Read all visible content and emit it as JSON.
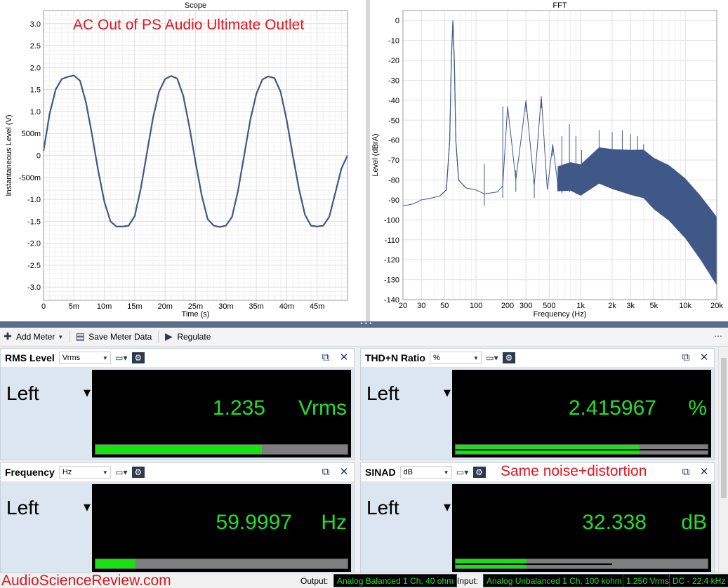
{
  "watermark": "AudioScienceReview.com",
  "annotations": {
    "scope": "AC Out of PS Audio Ultimate Outlet",
    "meters": "Same noise+distortion"
  },
  "colors": {
    "trace": "#3f5888",
    "grid": "#e1e1e1",
    "meter_green": "#22e02a",
    "annotation_red": "#e8121d"
  },
  "chart_data": [
    {
      "type": "line",
      "title": "Scope",
      "xlabel": "Time (s)",
      "ylabel": "Instantaneous Level (V)",
      "xlim": [
        0,
        0.05
      ],
      "ylim": [
        -3.3,
        3.3
      ],
      "x_ticks": [
        "0",
        "5m",
        "10m",
        "15m",
        "20m",
        "25m",
        "30m",
        "35m",
        "40m",
        "45m"
      ],
      "y_ticks": [
        "3.0",
        "2.5",
        "2.0",
        "1.5",
        "1.0",
        "500m",
        "0",
        "-500m",
        "-1.0",
        "-1.5",
        "-2.0",
        "-2.5",
        "-3.0"
      ],
      "grid": true,
      "series": [
        {
          "x": [
            0,
            0.001,
            0.002,
            0.003,
            0.004,
            0.005,
            0.006,
            0.007,
            0.008,
            0.009,
            0.01,
            0.011,
            0.012,
            0.013,
            0.014,
            0.015,
            0.016,
            0.017,
            0.018,
            0.019,
            0.02,
            0.021,
            0.022,
            0.023,
            0.024,
            0.025,
            0.026,
            0.027,
            0.028,
            0.029,
            0.03,
            0.031,
            0.032,
            0.033,
            0.034,
            0.035,
            0.036,
            0.037,
            0.038,
            0.039,
            0.04,
            0.041,
            0.042,
            0.043,
            0.044,
            0.045,
            0.046,
            0.047,
            0.048,
            0.049,
            0.05
          ],
          "y": [
            0.1,
            0.95,
            1.5,
            1.74,
            1.79,
            1.82,
            1.7,
            1.2,
            0.45,
            -0.35,
            -1.05,
            -1.5,
            -1.62,
            -1.62,
            -1.6,
            -1.38,
            -0.75,
            0.05,
            0.85,
            1.45,
            1.74,
            1.81,
            1.75,
            1.35,
            0.65,
            -0.15,
            -0.9,
            -1.45,
            -1.6,
            -1.63,
            -1.6,
            -1.4,
            -0.8,
            0.0,
            0.8,
            1.4,
            1.73,
            1.8,
            1.76,
            1.45,
            0.8,
            0.0,
            -0.75,
            -1.35,
            -1.6,
            -1.62,
            -1.6,
            -1.4,
            -0.85,
            -0.3,
            0.0
          ]
        }
      ]
    },
    {
      "type": "line",
      "title": "FFT",
      "xlabel": "Frequency (Hz)",
      "ylabel": "Level (dBrA)",
      "x_scale": "log",
      "xlim": [
        20,
        20000
      ],
      "ylim": [
        -140,
        5
      ],
      "x_ticks": [
        "20",
        "30",
        "50",
        "100",
        "200",
        "300",
        "500",
        "1k",
        "2k",
        "3k",
        "5k",
        "10k",
        "20k"
      ],
      "y_ticks": [
        "0",
        "-10",
        "-20",
        "-30",
        "-40",
        "-50",
        "-60",
        "-70",
        "-80",
        "-90",
        "-100",
        "-110",
        "-120",
        "-130",
        "-140"
      ],
      "grid": true,
      "series": [
        {
          "x": [
            20,
            25,
            30,
            38,
            45,
            52,
            56,
            58,
            60,
            62,
            64,
            68,
            80,
            100,
            120,
            160,
            180,
            200,
            240,
            300,
            360,
            420,
            480,
            540,
            600,
            800,
            1000,
            1500,
            2000,
            3000,
            4000,
            5000,
            7000,
            10000,
            14000,
            20000
          ],
          "y": [
            -93,
            -92,
            -90,
            -89,
            -88,
            -85,
            -60,
            -20,
            0,
            -20,
            -60,
            -80,
            -84,
            -85,
            -87,
            -86,
            -83,
            -43,
            -80,
            -40,
            -83,
            -38,
            -85,
            -62,
            -81,
            -80,
            -82,
            -75,
            -77,
            -79,
            -80,
            -85,
            -90,
            -98,
            -108,
            -120
          ]
        }
      ],
      "harmonic_peaks": {
        "x": [
          120,
          180,
          240,
          300,
          360,
          420,
          540,
          660,
          780,
          900,
          1020,
          1500,
          2000,
          2500,
          3000,
          3500,
          4000,
          5000,
          6000,
          7000,
          8000,
          10000,
          12000,
          15000
        ],
        "y": [
          -72,
          -43,
          -75,
          -40,
          -80,
          -38,
          -62,
          -58,
          -52,
          -58,
          -65,
          -55,
          -56,
          -55,
          -57,
          -58,
          -62,
          -70,
          -72,
          -75,
          -78,
          -82,
          -88,
          -95
        ]
      }
    }
  ],
  "toolbar": {
    "add_meter": "Add Meter",
    "save_meter_data": "Save Meter Data",
    "regulate": "Regulate"
  },
  "meters": [
    {
      "title": "RMS Level",
      "unit_option": "Vrms",
      "channel": "Left",
      "value": "1.235",
      "unit": "Vrms",
      "bar_fraction": 0.66,
      "line_fraction": 0
    },
    {
      "title": "THD+N Ratio",
      "unit_option": "%",
      "channel": "Left",
      "value": "2.415967",
      "unit": "%",
      "bar_fraction": 0.73,
      "line_fraction": 1.0
    },
    {
      "title": "Frequency",
      "unit_option": "Hz",
      "channel": "Left",
      "value": "59.9997",
      "unit": "Hz",
      "bar_fraction": 0.16,
      "line_fraction": 0
    },
    {
      "title": "SINAD",
      "unit_option": "dB",
      "channel": "Left",
      "value": "32.338",
      "unit": "dB",
      "bar_fraction": 0.28,
      "line_fraction": 0.62
    }
  ],
  "status": {
    "output_label": "Output:",
    "output_value": "Analog Balanced 1 Ch, 40 ohm",
    "input_label": "Input:",
    "input_value": "Analog Unbalanced 1 Ch, 100 kohm",
    "level": "1.250 Vrms",
    "bandwidth": "DC - 22.4 kHz"
  }
}
